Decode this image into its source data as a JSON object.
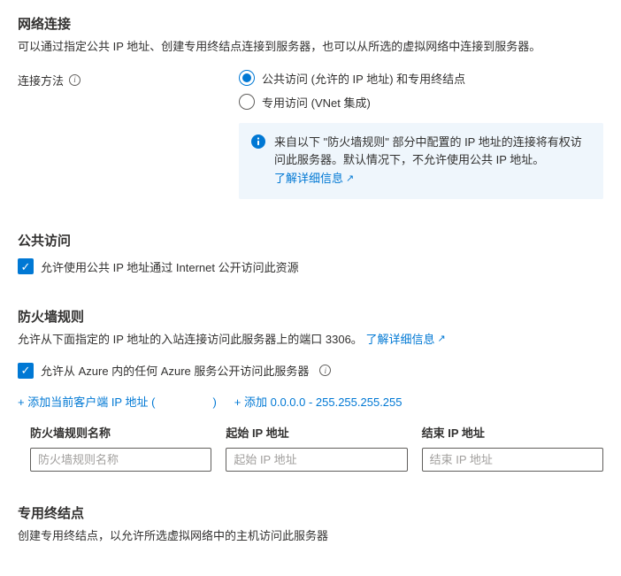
{
  "network": {
    "heading": "网络连接",
    "desc": "可以通过指定公共 IP 地址、创建专用终结点连接到服务器，也可以从所选的虚拟网络中连接到服务器。"
  },
  "connectMethod": {
    "label": "连接方法",
    "options": {
      "public": "公共访问 (允许的 IP 地址) 和专用终结点",
      "private": "专用访问 (VNet 集成)"
    }
  },
  "infoBox": {
    "text1": "来自以下 \"防火墙规则\" 部分中配置的 IP 地址的连接将有权访问此服务器。默认情况下，不允许使用公共 IP 地址。",
    "learnMore": "了解详细信息"
  },
  "publicAccess": {
    "heading": "公共访问",
    "checkboxLabel": "允许使用公共 IP 地址通过 Internet 公开访问此资源"
  },
  "firewall": {
    "heading": "防火墙规则",
    "desc": "允许从下面指定的 IP 地址的入站连接访问此服务器上的端口 3306。",
    "learnMore": "了解详细信息",
    "allowAzure": "允许从 Azure 内的任何 Azure 服务公开访问此服务器",
    "addCurrent": "+ 添加当前客户端 IP 地址 (",
    "addCurrentEnd": ")",
    "addRange": "+ 添加 0.0.0.0 - 255.255.255.255",
    "cols": {
      "name": "防火墙规则名称",
      "start": "起始 IP 地址",
      "end": "结束 IP 地址"
    },
    "placeholders": {
      "name": "防火墙规则名称",
      "start": "起始 IP 地址",
      "end": "结束 IP 地址"
    }
  },
  "privateEndpoint": {
    "heading": "专用终结点",
    "desc": "创建专用终结点，以允许所选虚拟网络中的主机访问此服务器"
  }
}
